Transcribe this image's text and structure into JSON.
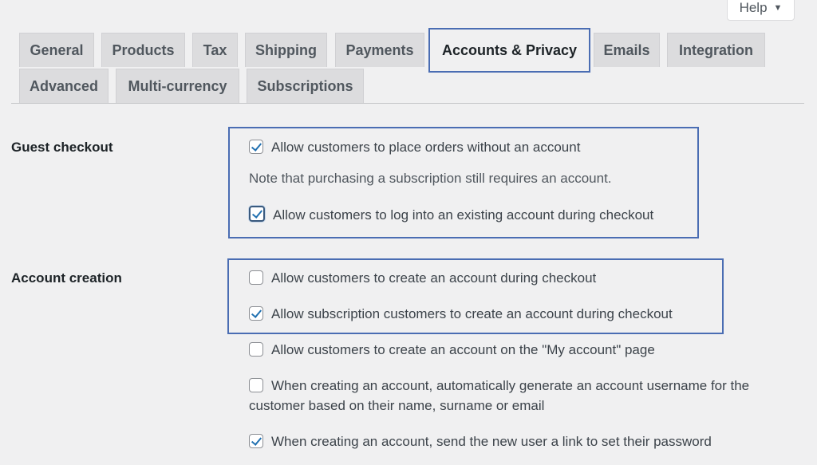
{
  "help": {
    "label": "Help",
    "caret": "▼"
  },
  "tabs": [
    {
      "label": "General",
      "active": false
    },
    {
      "label": "Products",
      "active": false
    },
    {
      "label": "Tax",
      "active": false
    },
    {
      "label": "Shipping",
      "active": false
    },
    {
      "label": "Payments",
      "active": false
    },
    {
      "label": "Accounts & Privacy",
      "active": true
    },
    {
      "label": "Emails",
      "active": false
    },
    {
      "label": "Integration",
      "active": false
    },
    {
      "label": "Advanced",
      "active": false
    },
    {
      "label": "Multi-currency",
      "active": false
    },
    {
      "label": "Subscriptions",
      "active": false
    }
  ],
  "guest_checkout": {
    "label": "Guest checkout",
    "options": [
      {
        "label": "Allow customers to place orders without an account",
        "checked": true
      },
      {
        "label": "Allow customers to log into an existing account during checkout",
        "checked": true
      }
    ],
    "note": "Note that purchasing a subscription still requires an account."
  },
  "account_creation": {
    "label": "Account creation",
    "options": [
      {
        "label": "Allow customers to create an account during checkout",
        "checked": false
      },
      {
        "label": "Allow subscription customers to create an account during checkout",
        "checked": true
      },
      {
        "label": "Allow customers to create an account on the \"My account\" page",
        "checked": false
      },
      {
        "label": "When creating an account, automatically generate an account username for the",
        "label_cont": "customer based on their name, surname or email",
        "checked": false
      },
      {
        "label": "When creating an account, send the new user a link to set their password",
        "checked": true
      }
    ]
  },
  "colors": {
    "highlight": "#4a6db3",
    "checkmark": "#2271b1",
    "background": "#f0f0f1"
  }
}
